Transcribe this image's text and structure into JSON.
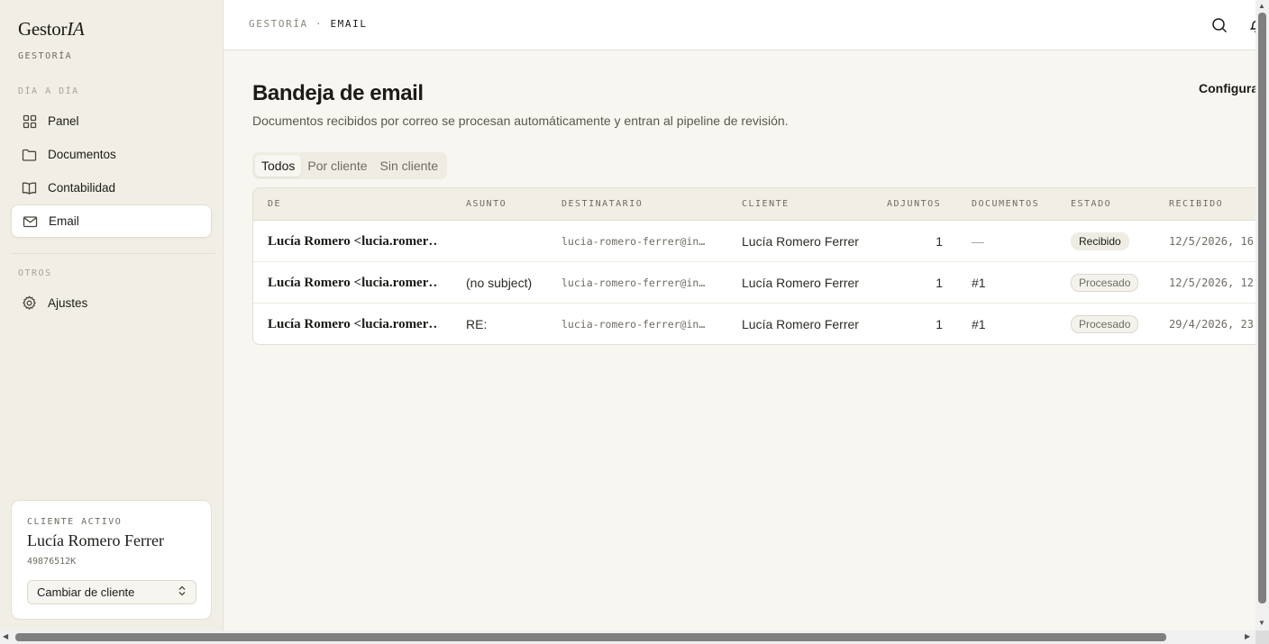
{
  "brand": {
    "name_prefix": "Gestor",
    "name_suffix": "IA",
    "subtitle": "GESTORÍA"
  },
  "sidebar": {
    "section_daily": "DÍA A DÍA",
    "items": [
      {
        "label": "Panel",
        "icon": "grid-icon"
      },
      {
        "label": "Documentos",
        "icon": "folder-icon"
      },
      {
        "label": "Contabilidad",
        "icon": "book-icon"
      },
      {
        "label": "Email",
        "icon": "mail-icon",
        "active": true
      }
    ],
    "section_other": "OTROS",
    "other_items": [
      {
        "label": "Ajustes",
        "icon": "gear-icon"
      }
    ]
  },
  "client_card": {
    "label": "CLIENTE ACTIVO",
    "name": "Lucía Romero Ferrer",
    "nif": "49876512K",
    "button_label": "Cambiar de cliente"
  },
  "topbar": {
    "breadcrumb_parent": "GESTORÍA",
    "separator": " · ",
    "breadcrumb_current": "EMAIL"
  },
  "page": {
    "title": "Bandeja de email",
    "description": "Documentos recibidos por correo se procesan automáticamente y entran al pipeline de revisión.",
    "config_label": "Configura"
  },
  "tabs": [
    "Todos",
    "Por cliente",
    "Sin cliente"
  ],
  "table": {
    "headers": [
      "DE",
      "ASUNTO",
      "DESTINATARIO",
      "CLIENTE",
      "ADJUNTOS",
      "DOCUMENTOS",
      "ESTADO",
      "RECIBIDO"
    ],
    "rows": [
      {
        "de": "Lucía Romero <lucia.romer…",
        "asunto": "",
        "destinatario": "lucia-romero-ferrer@in…",
        "cliente": "Lucía Romero Ferrer",
        "adjuntos": "1",
        "documentos": "—",
        "estado": "Recibido",
        "recibido": "12/5/2026, 16"
      },
      {
        "de": "Lucía Romero <lucia.romer…",
        "asunto": "(no subject)",
        "destinatario": "lucia-romero-ferrer@in…",
        "cliente": "Lucía Romero Ferrer",
        "adjuntos": "1",
        "documentos": "#1",
        "estado": "Procesado",
        "recibido": "12/5/2026, 12"
      },
      {
        "de": "Lucía Romero <lucia.romer…",
        "asunto": "RE:",
        "destinatario": "lucia-romero-ferrer@in…",
        "cliente": "Lucía Romero Ferrer",
        "adjuntos": "1",
        "documentos": "#1",
        "estado": "Procesado",
        "recibido": "29/4/2026, 23"
      }
    ]
  },
  "colors": {
    "background": "#f8f6f1",
    "sidebar": "#f1eee5",
    "text": "#1c1b18",
    "muted": "#6f6b62"
  }
}
